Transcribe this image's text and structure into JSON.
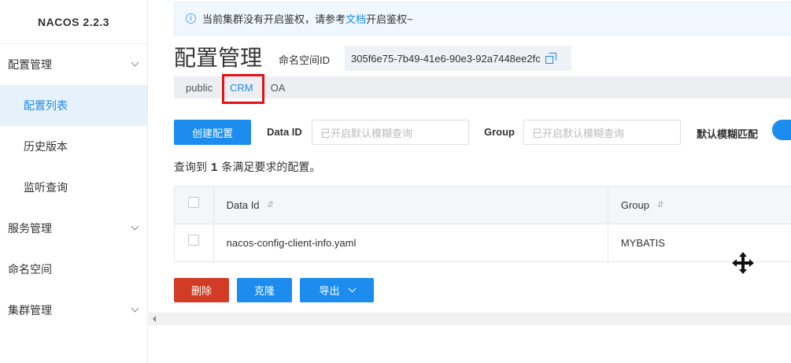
{
  "sidebar": {
    "brand": "NACOS 2.2.3",
    "groups": [
      {
        "label": "配置管理"
      },
      {
        "label": "服务管理"
      },
      {
        "label": "命名空间"
      },
      {
        "label": "集群管理"
      }
    ],
    "config_items": [
      {
        "label": "配置列表",
        "active": true
      },
      {
        "label": "历史版本"
      },
      {
        "label": "监听查询"
      }
    ]
  },
  "notice": {
    "text_before": "当前集群没有开启鉴权，请参考",
    "link": "文档",
    "text_after": "开启鉴权~"
  },
  "page": {
    "title": "配置管理",
    "namespace_label": "命名空间ID",
    "namespace_id": "305f6e75-7b49-41e6-90e3-92a7448ee2fc"
  },
  "namespaces": [
    {
      "label": "public"
    },
    {
      "label": "CRM",
      "active": true
    },
    {
      "label": "OA"
    }
  ],
  "toolbar": {
    "create_label": "创建配置",
    "data_id_label": "Data ID",
    "data_id_placeholder": "已开启默认模糊查询",
    "group_label": "Group",
    "group_placeholder": "已开启默认模糊查询",
    "fuzzy_label": "默认模糊匹配"
  },
  "result": {
    "prefix": "查询到",
    "count": "1",
    "suffix": "条满足要求的配置。"
  },
  "table": {
    "headers": {
      "data_id": "Data Id",
      "group": "Group"
    },
    "rows": [
      {
        "data_id": "nacos-config-client-info.yaml",
        "group": "MYBATIS"
      }
    ]
  },
  "actions": {
    "delete": "删除",
    "clone": "克隆",
    "export": "导出"
  },
  "colors": {
    "primary": "#1c8cee",
    "danger": "#d23c26",
    "highlight_box": "#e1121a"
  }
}
